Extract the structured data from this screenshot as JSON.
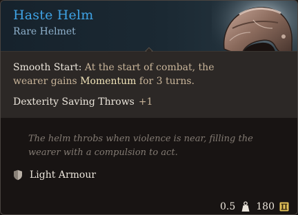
{
  "item": {
    "name": "Haste Helm",
    "rarity_type": "Rare Helmet"
  },
  "ability": {
    "name": "Smooth Start:",
    "text_before": " At the start of combat, the",
    "line2_before": "wearer gains ",
    "keyword": "Momentum",
    "line2_after": " for 3 turns."
  },
  "bonus": {
    "label": "Dexterity Saving Throws",
    "value": "+1"
  },
  "flavor_text": "The helm throbs when violence is near, filling the wearer with a compulsion to act.",
  "armour": {
    "icon": "shield-icon",
    "label": "Light Armour"
  },
  "footer": {
    "weight": "0.5",
    "weight_icon": "weight-icon",
    "value": "180",
    "value_icon": "gold-coin-icon"
  },
  "colors": {
    "title": "#3fa3e6",
    "rarity": "#8fb1cc",
    "keyword": "#f1e4b9",
    "body": "#c9b59a",
    "flavor": "#837b73"
  }
}
